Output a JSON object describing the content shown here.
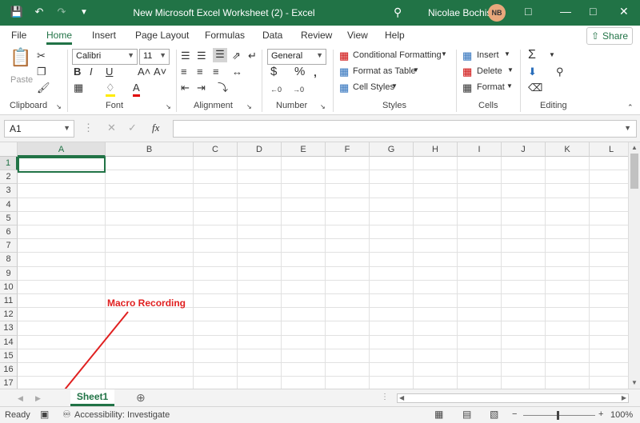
{
  "window": {
    "title": "New Microsoft Excel Worksheet (2)  -  Excel",
    "user_name": "Nicolae Bochis",
    "user_initials": "NB"
  },
  "menu": {
    "tabs": [
      "File",
      "Home",
      "Insert",
      "Page Layout",
      "Formulas",
      "Data",
      "Review",
      "View",
      "Help"
    ],
    "active": "Home",
    "share_label": "Share"
  },
  "ribbon": {
    "clipboard": {
      "label": "Clipboard",
      "paste_label": "Paste"
    },
    "font": {
      "label": "Font",
      "font_name": "Calibri",
      "font_size": "11"
    },
    "alignment": {
      "label": "Alignment"
    },
    "number": {
      "label": "Number",
      "format": "General"
    },
    "styles": {
      "label": "Styles",
      "conditional_formatting": "Conditional Formatting",
      "format_as_table": "Format as Table",
      "cell_styles": "Cell Styles"
    },
    "cells": {
      "label": "Cells",
      "insert": "Insert",
      "delete": "Delete",
      "format": "Format"
    },
    "editing": {
      "label": "Editing"
    }
  },
  "formula_bar": {
    "name_box": "A1",
    "fx": "fx",
    "value": ""
  },
  "grid": {
    "columns": [
      "A",
      "B",
      "C",
      "D",
      "E",
      "F",
      "G",
      "H",
      "I",
      "J",
      "K",
      "L"
    ],
    "rows": [
      "1",
      "2",
      "3",
      "4",
      "5",
      "6",
      "7",
      "8",
      "9",
      "10",
      "11",
      "12",
      "13",
      "14",
      "15",
      "16",
      "17"
    ],
    "active_cell": "A1"
  },
  "annotation": {
    "text": "Macro Recording",
    "color": "#e02020"
  },
  "sheets": {
    "tabs": [
      "Sheet1"
    ],
    "active": "Sheet1"
  },
  "status": {
    "ready": "Ready",
    "accessibility": "Accessibility: Investigate",
    "zoom": "100%"
  },
  "colors": {
    "accent": "#217346"
  }
}
